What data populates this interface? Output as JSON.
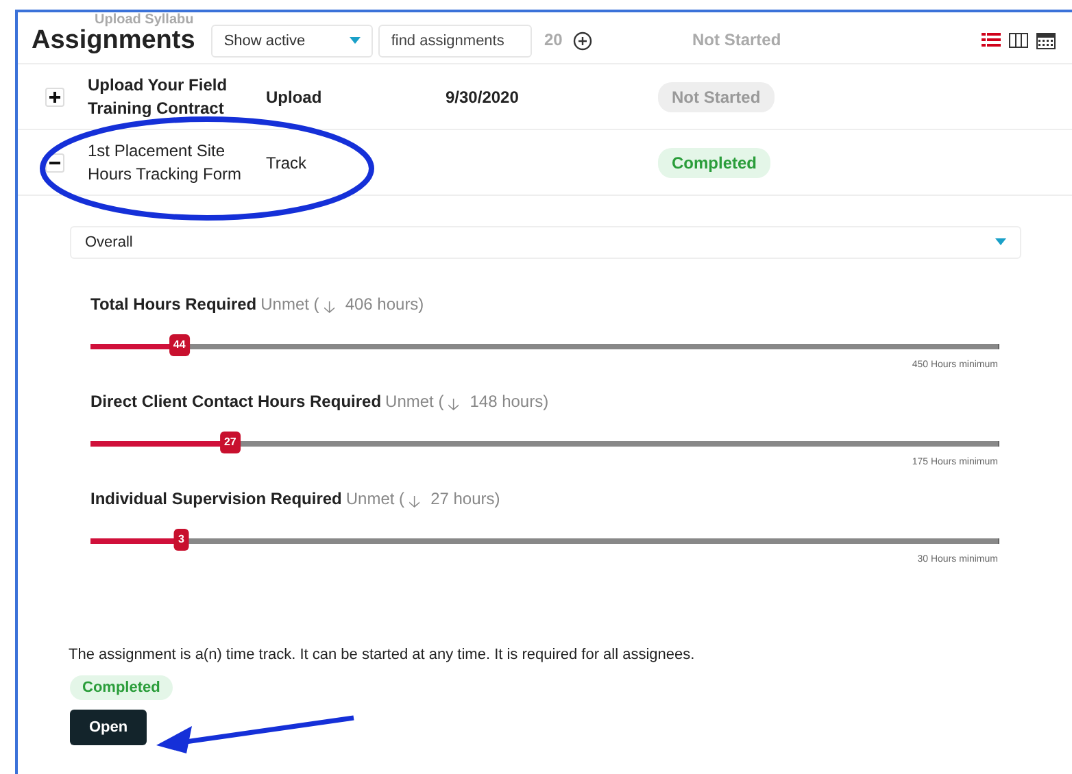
{
  "header": {
    "title": "Assignments",
    "filter": {
      "value": "Show active"
    },
    "search": {
      "placeholder": "find assignments"
    },
    "views": [
      {
        "kind": "list",
        "selected": true
      },
      {
        "kind": "columns",
        "selected": false
      },
      {
        "kind": "calendar",
        "selected": false
      }
    ]
  },
  "scrolled_row": {
    "title": "Upload Syllabu",
    "date": "20",
    "status": "Not Started"
  },
  "rows": [
    {
      "title": "Upload Your Field Training Contract",
      "type": "Upload",
      "date": "9/30/2020",
      "status": "Not Started",
      "completed": false,
      "expanded": false
    },
    {
      "title": "1st Placement Site Hours Tracking Form",
      "type": "Track",
      "date": "",
      "status": "Completed",
      "completed": true,
      "expanded": true
    }
  ],
  "detail": {
    "select": {
      "value": "Overall"
    },
    "requirements": [
      {
        "name": "Total Hours Required",
        "state": "Unmet (",
        "arrow": "🡣",
        "remaining": "406 hours)",
        "value": "44",
        "level": 0.098,
        "minimum": "450 Hours minimum"
      },
      {
        "name": "Direct Client Contact Hours Required",
        "state": "Unmet (",
        "arrow": "🡣",
        "remaining": "148 hours)",
        "value": "27",
        "level": 0.154,
        "minimum": "175 Hours minimum"
      },
      {
        "name": "Individual Supervision Required",
        "state": "Unmet (",
        "arrow": "🡣",
        "remaining": "27 hours)",
        "value": "3",
        "level": 0.1,
        "minimum": "30 Hours minimum"
      }
    ],
    "description": "The assignment is a(n) time track. It can be started at any time. It is required for all assignees.",
    "status": "Completed",
    "completed": true,
    "open_button": "Open"
  }
}
